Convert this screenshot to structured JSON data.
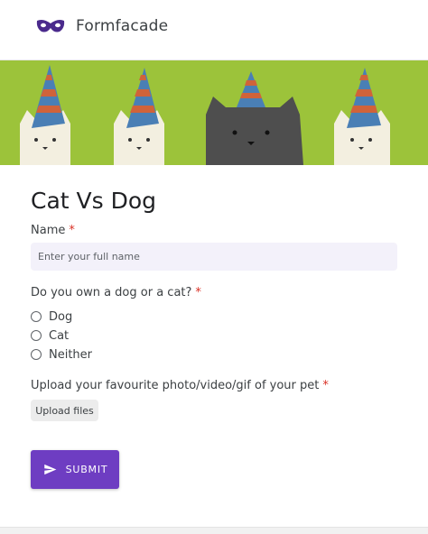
{
  "header": {
    "brand": "Formfacade",
    "logo_icon": "mask-logo-icon"
  },
  "banner": {
    "image": "cats-with-party-hats-illustration"
  },
  "form": {
    "title": "Cat Vs Dog",
    "questions": [
      {
        "label": "Name",
        "required_mark": "*",
        "placeholder": "Enter your full name",
        "value": ""
      },
      {
        "label": "Do you own a dog or a cat?",
        "required_mark": "*",
        "options": [
          "Dog",
          "Cat",
          "Neither"
        ]
      },
      {
        "label": "Upload your favourite photo/video/gif of your pet",
        "required_mark": "*",
        "button_label": "Upload files"
      }
    ],
    "submit_label": "SUBMIT"
  },
  "colors": {
    "accent": "#6e3dc2",
    "required": "#d93025",
    "banner": "#9cc33a",
    "input_bg": "#f3f1fa"
  }
}
